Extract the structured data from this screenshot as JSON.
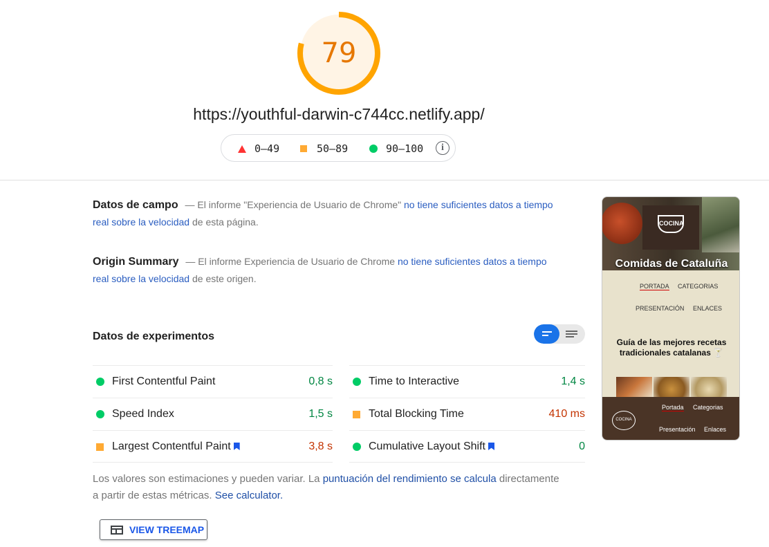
{
  "score": {
    "value": "79",
    "fraction": 0.79
  },
  "url": "https://youthful-darwin-c744cc.netlify.app/",
  "legend": {
    "fail": "0–49",
    "average": "50–89",
    "pass": "90–100",
    "info_icon": "i"
  },
  "field_data": {
    "title": "Datos de campo",
    "pre": "— El informe \"Experiencia de Usuario de Chrome\" ",
    "link": "no tiene suficientes datos a tiempo real sobre la velocidad",
    "post": " de esta página."
  },
  "origin_summary": {
    "title": "Origin Summary",
    "pre": "— El informe Experiencia de Usuario de Chrome ",
    "link": "no tiene suficientes datos a tiempo real sobre la velocidad",
    "post": " de este origen."
  },
  "lab_title": "Datos de experimentos",
  "metrics": [
    {
      "name": "First Contentful Paint",
      "value": "0,8 s",
      "rating": "pass"
    },
    {
      "name": "Time to Interactive",
      "value": "1,4 s",
      "rating": "pass"
    },
    {
      "name": "Speed Index",
      "value": "1,5 s",
      "rating": "pass"
    },
    {
      "name": "Total Blocking Time",
      "value": "410 ms",
      "rating": "average"
    },
    {
      "name": "Largest Contentful Paint",
      "value": "3,8 s",
      "rating": "average"
    },
    {
      "name": "Cumulative Layout Shift",
      "value": "0",
      "rating": "pass"
    }
  ],
  "note": {
    "pre": "Los valores son estimaciones y pueden variar. La ",
    "link1": "puntuación del rendimiento se calcula",
    "mid": " directamente a partir de estas métricas. ",
    "link2": "See calculator."
  },
  "treemap_button": "VIEW TREEMAP",
  "screenshot": {
    "logo": "COCINA",
    "title": "Comidas de Cataluña",
    "nav": [
      "PORTADA",
      "CATEGORIAS",
      "PRESENTACIÓN",
      "ENLACES"
    ],
    "heading": "Guía de las mejores recetas tradicionales catalanas",
    "footer_logo": "COCINA",
    "footer_nav": [
      "Portada",
      "Categorias",
      "Presentación",
      "Enlaces"
    ]
  },
  "colors": {
    "average": "#ffaa33",
    "pass": "#00cc66",
    "fail": "#ff3333",
    "link": "#1a73e8"
  }
}
